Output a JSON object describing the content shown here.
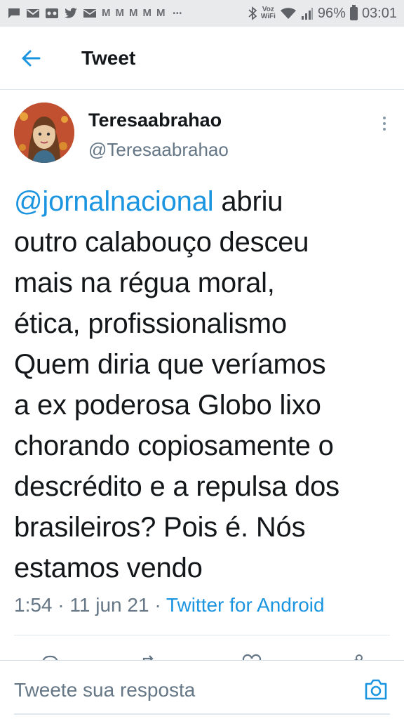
{
  "status_bar": {
    "notification_icons": [
      "chat-icon",
      "gmail-icon",
      "voicemail-icon",
      "twitter-icon",
      "mail-icon",
      "gmail-icon",
      "gmail-icon",
      "gmail-icon",
      "gmail-icon",
      "gmail-icon"
    ],
    "more": "•••",
    "voz": "Voz",
    "wifi_label": "WiFi",
    "battery": "96%",
    "time": "03:01"
  },
  "header": {
    "title": "Tweet"
  },
  "tweet": {
    "display_name": "Teresaabrahao",
    "handle": "@Teresaabrahao",
    "mention": "@jornalnacional",
    "lines": [
      " abriu",
      "outro calabouço desceu",
      "mais na régua moral,",
      "ética, profissionalismo",
      "Quem diria que veríamos",
      "a ex poderosa Globo lixo",
      "chorando copiosamente o",
      "descrédito e a repulsa dos",
      "brasileiros? Pois é. Nós",
      "estamos vendo"
    ],
    "time": "1:54",
    "date": "11 jun 21",
    "separator": "·",
    "source": "Twitter for Android"
  },
  "reply": {
    "placeholder": "Tweete sua resposta"
  },
  "colors": {
    "accent": "#1b95e0",
    "text": "#14171a",
    "secondary": "#657786",
    "status_bar_bg": "#e8eaec"
  }
}
